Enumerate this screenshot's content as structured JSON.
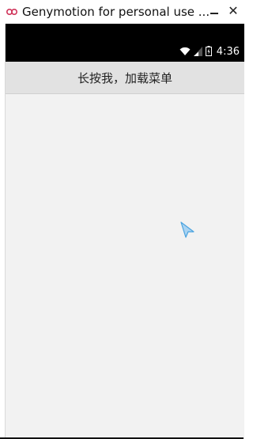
{
  "window": {
    "title": "Genymotion for personal use ...",
    "minimize_label": "—",
    "close_label": "✕",
    "app_icon": "genymotion-logo-icon"
  },
  "status_bar": {
    "time": "4:36",
    "icons": [
      "wifi-icon",
      "signal-icon",
      "battery-icon"
    ]
  },
  "action_bar": {
    "label": "长按我，加载菜单"
  },
  "colors": {
    "status_bar": "#000000",
    "action_bar": "#e2e2e2",
    "content": "#f2f2f2",
    "cursor": "#4aa3df"
  }
}
